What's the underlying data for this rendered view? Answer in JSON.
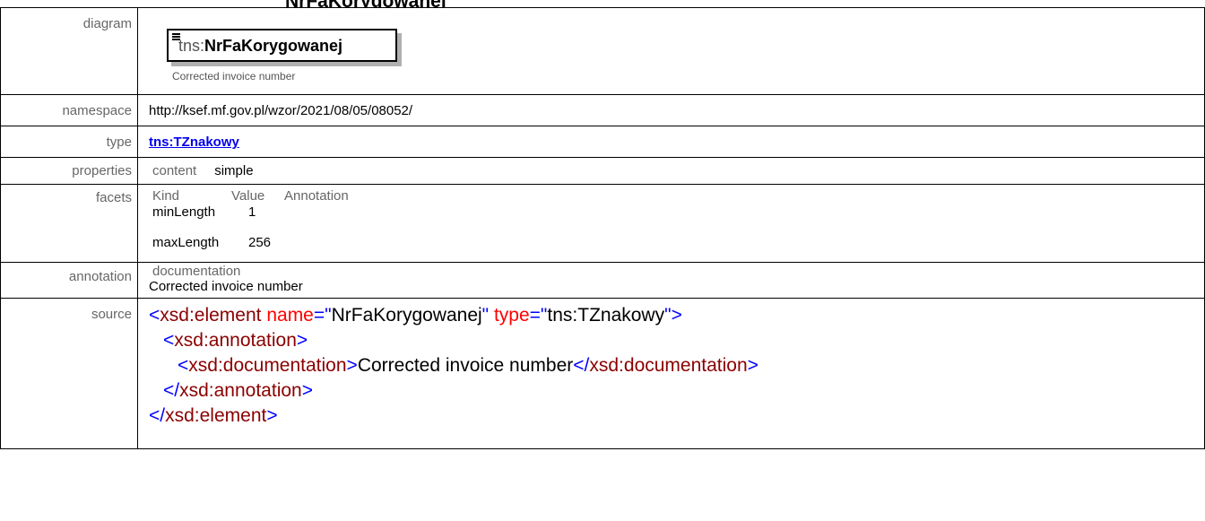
{
  "header": {
    "title_fragment": "NrFaKorygowanej"
  },
  "rows": {
    "diagram": {
      "label": "diagram",
      "element_prefix": "tns:",
      "element_name": "NrFaKorygowanej",
      "note": "Corrected invoice number"
    },
    "namespace": {
      "label": "namespace",
      "value": "http://ksef.mf.gov.pl/wzor/2021/08/05/08052/"
    },
    "type": {
      "label": "type",
      "value": "tns:TZnakowy"
    },
    "properties": {
      "label": "properties",
      "key": "content",
      "value": "simple"
    },
    "facets": {
      "label": "facets",
      "headers": {
        "kind": "Kind",
        "value": "Value",
        "annotation": "Annotation"
      },
      "items": [
        {
          "kind": "minLength",
          "value": "1"
        },
        {
          "kind": "maxLength",
          "value": "256"
        }
      ]
    },
    "annotation": {
      "label": "annotation",
      "heading": "documentation",
      "text": "Corrected invoice number"
    },
    "source": {
      "label": "source",
      "lines": {
        "l1_open": "<",
        "l1_tag": "xsd:element",
        "l1_attr1": " name",
        "l1_eq1": "=\"",
        "l1_val1": "NrFaKorygowanej",
        "l1_q1": "\"",
        "l1_attr2": " type",
        "l1_eq2": "=\"",
        "l1_val2": "tns:TZnakowy",
        "l1_close": "\">",
        "l2_open": "<",
        "l2_tag": "xsd:annotation",
        "l2_close": ">",
        "l3_open": "<",
        "l3_tag": "xsd:documentation",
        "l3_mid": ">",
        "l3_text": "Corrected invoice number",
        "l3_end_open": "</",
        "l3_end_tag": "xsd:documentation",
        "l3_end_close": ">",
        "l4_open": "</",
        "l4_tag": "xsd:annotation",
        "l4_close": ">",
        "l5_open": "</",
        "l5_tag": "xsd:element",
        "l5_close": ">"
      }
    }
  },
  "colors": {
    "tag": "#8b0000",
    "bracket": "#0000ff",
    "attribute": "#ff0000",
    "link": "#0000ee",
    "label": "#666666"
  }
}
